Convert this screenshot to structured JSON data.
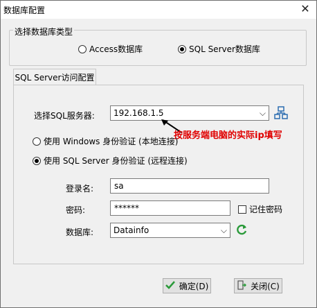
{
  "window": {
    "title": "数据库配置"
  },
  "db_type": {
    "legend": "选择数据库类型",
    "options": [
      {
        "label": "Access数据库",
        "checked": false
      },
      {
        "label": "SQL Server数据库",
        "checked": true
      }
    ]
  },
  "tab": {
    "label": "SQL Server访问配置"
  },
  "server": {
    "label": "选择SQL服务器:",
    "value": "192.168.1.5"
  },
  "annotation": {
    "text": "按服务端电脑的实际ip填写"
  },
  "auth": {
    "windows_label": "使用 Windows 身份验证  (本地连接)",
    "sql_label": "使用 SQL Server 身份验证 (远程连接)",
    "selected": "sql"
  },
  "login": {
    "label": "登录名:",
    "value": "sa"
  },
  "password": {
    "label": "密码:",
    "value": "******",
    "remember_label": "记住密码",
    "remember_checked": false
  },
  "database": {
    "label": "数据库:",
    "value": "Datainfo"
  },
  "buttons": {
    "ok": "确定(D)",
    "close": "关闭(C)"
  },
  "icons": {
    "close": "close-icon",
    "network": "network-icon",
    "refresh": "refresh-icon",
    "ok": "checkmark-icon",
    "exit": "exit-icon",
    "dropdown": "chevron-down-icon"
  },
  "colors": {
    "annotation": "#e00000",
    "refresh": "#2a9a3a",
    "network": "#2b6cb0"
  }
}
